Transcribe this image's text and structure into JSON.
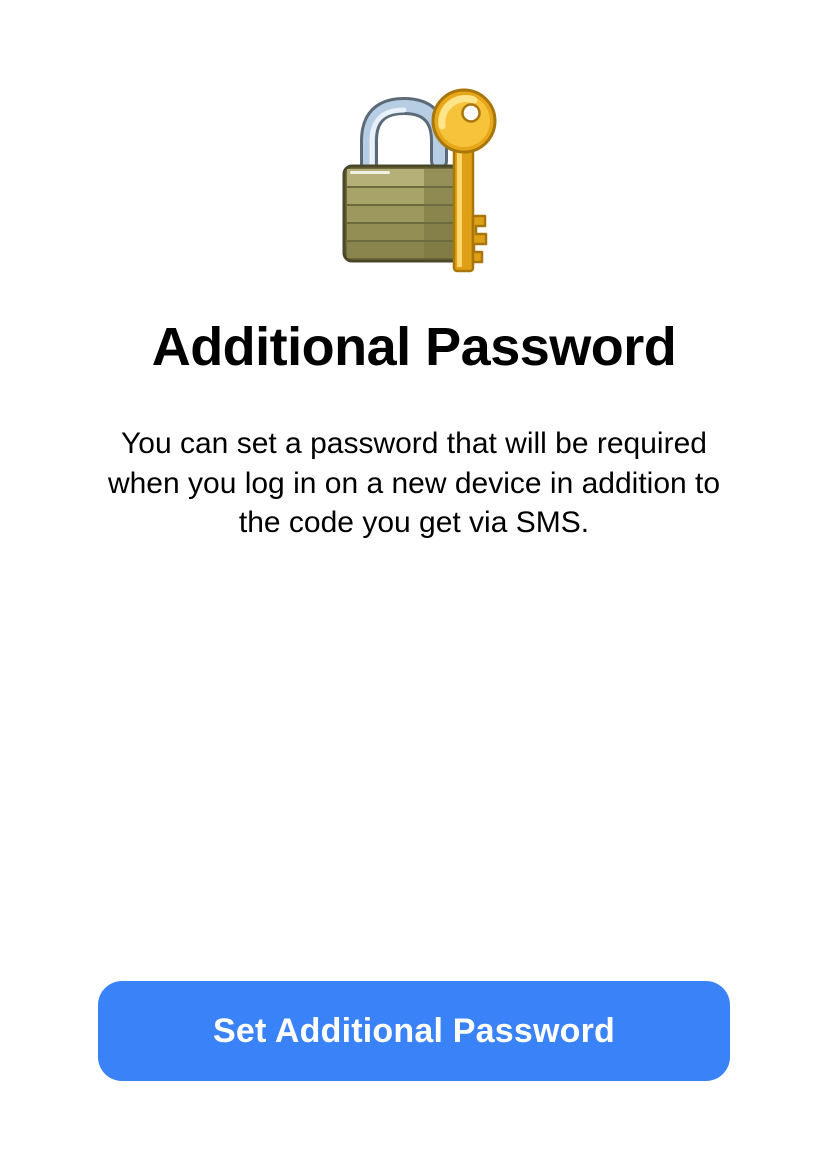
{
  "header": {
    "title": "Additional Password",
    "description": "You can set a password that will be required when you log in on a new device in addition to the code you get via SMS."
  },
  "actions": {
    "primary_label": "Set Additional Password"
  },
  "icons": {
    "hero": "padlock-with-key-icon"
  },
  "colors": {
    "primary_button": "#3a82f7",
    "text": "#000000",
    "background": "#ffffff"
  }
}
